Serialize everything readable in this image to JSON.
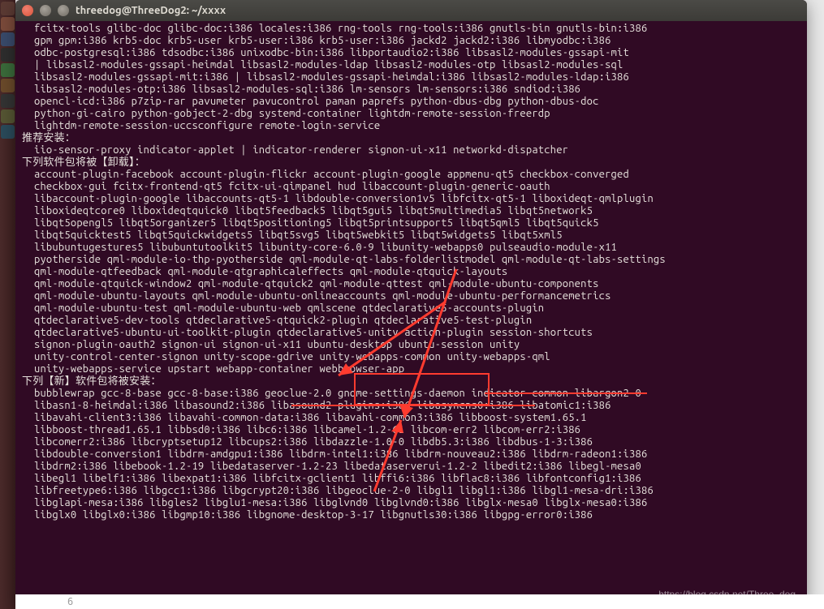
{
  "window": {
    "title": "threedog@ThreeDog2: ~/xxxx"
  },
  "terminal": {
    "block_suggested": [
      "  fcitx-tools glibc-doc glibc-doc:i386 locales:i386 rng-tools rng-tools:i386 gnutls-bin gnutls-bin:i386",
      "  gpm gpm:i386 krb5-doc krb5-user krb5-user:i386 krb5-user:i386 jackd2 jackd2:i386 libmyodbc:i386",
      "  odbc-postgresql:i386 tdsodbc:i386 unixodbc-bin:i386 libportaudio2:i386 libsasl2-modules-gssapi-mit",
      "  | libsasl2-modules-gssapi-heimdal libsasl2-modules-ldap libsasl2-modules-otp libsasl2-modules-sql",
      "  libsasl2-modules-gssapi-mit:i386 | libsasl2-modules-gssapi-heimdal:i386 libsasl2-modules-ldap:i386",
      "  libsasl2-modules-otp:i386 libsasl2-modules-sql:i386 lm-sensors lm-sensors:i386 sndiod:i386",
      "  opencl-icd:i386 p7zip-rar pavumeter pavucontrol paman paprefs python-dbus-dbg python-dbus-doc",
      "  python-gi-cairo python-gobject-2-dbg systemd-container lightdm-remote-session-freerdp",
      "  lightdm-remote-session-uccsconfigure remote-login-service"
    ],
    "hdr_recommended": "推荐安装：",
    "block_recommended": [
      "  iio-sensor-proxy indicator-applet | indicator-renderer signon-ui-x11 networkd-dispatcher"
    ],
    "hdr_remove": "下列软件包将被【卸载】：",
    "block_remove": [
      "  account-plugin-facebook account-plugin-flickr account-plugin-google appmenu-qt5 checkbox-converged",
      "  checkbox-gui fcitx-frontend-qt5 fcitx-ui-qimpanel hud libaccount-plugin-generic-oauth",
      "  libaccount-plugin-google libaccounts-qt5-1 libdouble-conversion1v5 libfcitx-qt5-1 liboxideqt-qmlplugin",
      "  liboxideqtcore0 liboxideqtquick0 libqt5feedback5 libqt5gui5 libqt5multimedia5 libqt5network5",
      "  libqt5opengl5 libqt5organizer5 libqt5positioning5 libqt5printsupport5 libqt5qml5 libqt5quick5",
      "  libqt5quicktest5 libqt5quickwidgets5 libqt5svg5 libqt5webkit5 libqt5widgets5 libqt5xml5",
      "  libubuntugestures5 libubuntutoolkit5 libunity-core-6.0-9 libunity-webapps0 pulseaudio-module-x11",
      "  pyotherside qml-module-io-thp-pyotherside qml-module-qt-labs-folderlistmodel qml-module-qt-labs-settings",
      "  qml-module-qtfeedback qml-module-qtgraphicaleffects qml-module-qtquick-layouts",
      "  qml-module-qtquick-window2 qml-module-qtquick2 qml-module-qttest qml-module-ubuntu-components",
      "  qml-module-ubuntu-layouts qml-module-ubuntu-onlineaccounts qml-module-ubuntu-performancemetrics",
      "  qml-module-ubuntu-test qml-module-ubuntu-web qmlscene qtdeclarative5-accounts-plugin",
      "  qtdeclarative5-dev-tools qtdeclarative5-qtquick2-plugin qtdeclarative5-test-plugin",
      "  qtdeclarative5-ubuntu-ui-toolkit-plugin qtdeclarative5-unity-action-plugin session-shortcuts",
      "  signon-plugin-oauth2 signon-ui signon-ui-x11 ubuntu-desktop ubuntu-session unity",
      "  unity-control-center-signon unity-scope-gdrive unity-webapps-common unity-webapps-qml",
      "  unity-webapps-service upstart webapp-container webbrowser-app"
    ],
    "hdr_new": "下列【新】软件包将被安装：",
    "block_new": [
      "  bubblewrap gcc-8-base gcc-8-base:i386 geoclue-2.0 gnome-settings-daemon indicator-common libargon2-0",
      "  libasn1-8-heimdal:i386 libasound2:i386 libasound2-plugins:i386 libasyncns0:i386 libatomic1:i386",
      "  libavahi-client3:i386 libavahi-common-data:i386 libavahi-common3:i386 libboost-system1.65.1",
      "  libboost-thread1.65.1 libbsd0:i386 libc6:i386 libcamel-1.2-61 libcom-err2 libcom-err2:i386",
      "  libcomerr2:i386 libcryptsetup12 libcups2:i386 libdazzle-1.0-0 libdb5.3:i386 libdbus-1-3:i386",
      "  libdouble-conversion1 libdrm-amdgpu1:i386 libdrm-intel1:i386 libdrm-nouveau2:i386 libdrm-radeon1:i386",
      "  libdrm2:i386 libebook-1.2-19 libedataserver-1.2-23 libedataserverui-1.2-2 libedit2:i386 libegl-mesa0",
      "  libegl1 libelf1:i386 libexpat1:i386 libfcitx-gclient1 libffi6:i386 libflac8:i386 libfontconfig1:i386",
      "  libfreetype6:i386 libgcc1:i386 libgcrypt20:i386 libgeoclue-2-0 libgl1 libgl1:i386 libgl1-mesa-dri:i386",
      "  libglapi-mesa:i386 libgles2 libglu1-mesa:i386 libglvnd0 libglvnd0:i386 libglx-mesa0 libglx-mesa0:i386",
      "  libglx0 libglx0:i386 libgmp10:i386 libgnome-desktop-3-17 libgnutls30:i386 libgpg-error0:i386"
    ]
  },
  "watermark": "https://blog.csdn.net/Three_dog",
  "bottom_strip": "6"
}
